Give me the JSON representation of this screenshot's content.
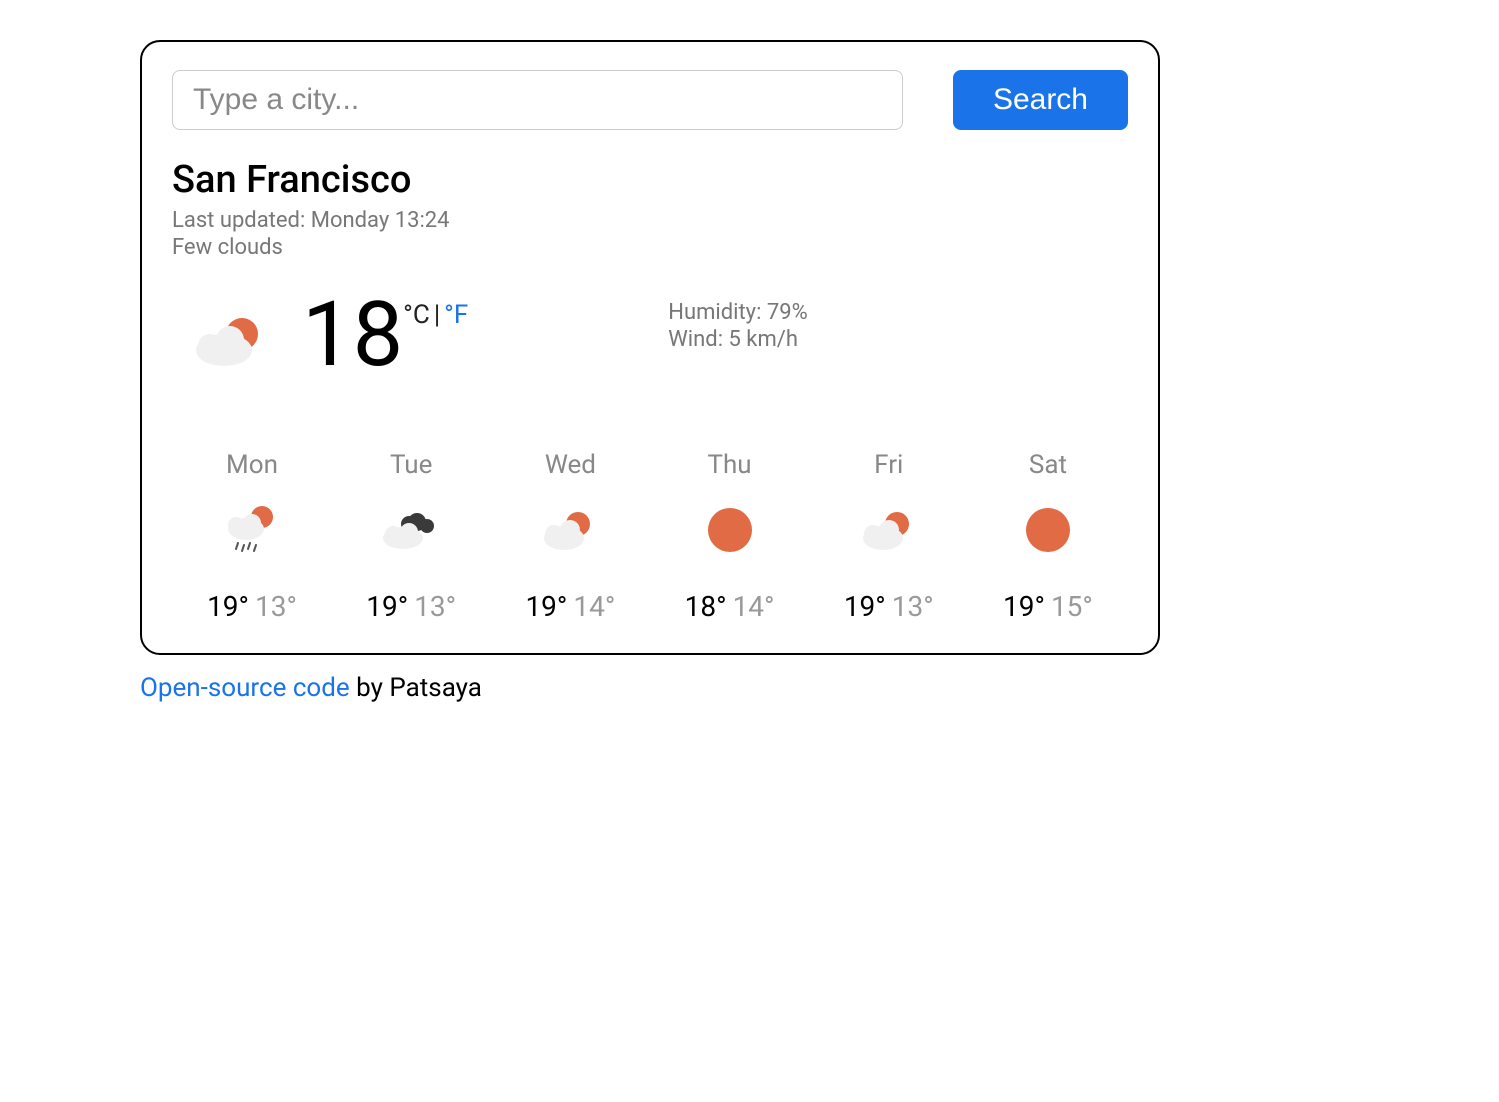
{
  "search": {
    "placeholder": "Type a city...",
    "button_label": "Search"
  },
  "current": {
    "city": "San Francisco",
    "updated_prefix": "Last updated: ",
    "updated_value": "Monday 13:24",
    "description": "Few clouds",
    "temp": "18",
    "unit_c": "°C",
    "unit_sep": "|",
    "unit_f": "°F",
    "humidity_label": "Humidity: ",
    "humidity_value": "79%",
    "wind_label": "Wind: ",
    "wind_value": "5 km/h",
    "icon": "partly-cloudy"
  },
  "forecast": [
    {
      "day": "Mon",
      "icon": "rain-sun",
      "high": "19°",
      "low": "13°"
    },
    {
      "day": "Tue",
      "icon": "cloudy-dark",
      "high": "19°",
      "low": "13°"
    },
    {
      "day": "Wed",
      "icon": "partly-cloudy",
      "high": "19°",
      "low": "14°"
    },
    {
      "day": "Thu",
      "icon": "sunny",
      "high": "18°",
      "low": "14°"
    },
    {
      "day": "Fri",
      "icon": "partly-cloudy",
      "high": "19°",
      "low": "13°"
    },
    {
      "day": "Sat",
      "icon": "sunny",
      "high": "19°",
      "low": "15°"
    }
  ],
  "footer": {
    "link_text": "Open-source code",
    "rest": " by Patsaya"
  },
  "colors": {
    "accent": "#1a73e8",
    "sun": "#e06b45",
    "cloud": "#f0f0f0",
    "dark_cloud": "#3a3a3a"
  }
}
